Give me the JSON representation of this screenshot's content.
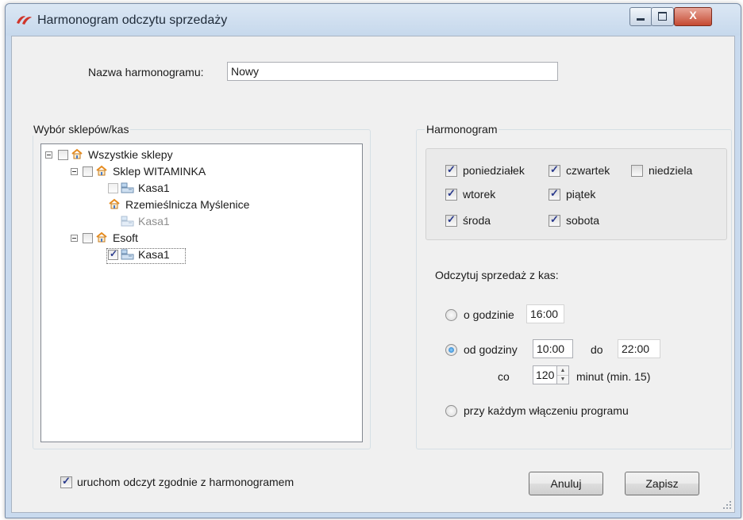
{
  "window": {
    "title": "Harmonogram odczytu sprzedaży",
    "buttons": {
      "minimize": "minimize",
      "maximize": "maximize",
      "close": "X"
    }
  },
  "name_field": {
    "label": "Nazwa harmonogramu:",
    "value": "Nowy"
  },
  "stores_group": {
    "title": "Wybór sklepów/kas",
    "tree": {
      "root": {
        "label": "Wszystkie sklepy",
        "checked": false
      },
      "stores": [
        {
          "label": "Sklep WITAMINKA",
          "checked": false,
          "registers": [
            {
              "label": "Kasa1",
              "checked": false,
              "enabled": false
            }
          ]
        },
        {
          "label": "Rzemieślnicza Myślenice",
          "registers": [
            {
              "label": "Kasa1",
              "enabled": false
            }
          ]
        },
        {
          "label": "Esoft",
          "checked": false,
          "registers": [
            {
              "label": "Kasa1",
              "checked": true,
              "enabled": true
            }
          ]
        }
      ]
    }
  },
  "schedule_group": {
    "title": "Harmonogram",
    "days": [
      {
        "label": "poniedziałek",
        "checked": true
      },
      {
        "label": "wtorek",
        "checked": true
      },
      {
        "label": "środa",
        "checked": true
      },
      {
        "label": "czwartek",
        "checked": true
      },
      {
        "label": "piątek",
        "checked": true
      },
      {
        "label": "sobota",
        "checked": true
      },
      {
        "label": "niedziela",
        "checked": false
      }
    ],
    "read_label": "Odczytuj sprzedaż z kas:",
    "at_hour": {
      "label": "o godzinie",
      "value": "16:00",
      "selected": false
    },
    "range": {
      "label": "od godziny",
      "from": "10:00",
      "to_label": "do",
      "to": "22:00",
      "selected": true,
      "every_label": "co",
      "interval": "120",
      "unit_label": "minut (min. 15)"
    },
    "on_start": {
      "label": "przy każdym włączeniu programu",
      "selected": false
    }
  },
  "run_checkbox": {
    "label": "uruchom odczyt zgodnie z harmonogramem",
    "checked": true
  },
  "actions": {
    "cancel": "Anuluj",
    "save": "Zapisz"
  },
  "colors": {
    "accent": "#1b6fc0",
    "close_button": "#c54a32",
    "check": "#2a3a8c"
  }
}
